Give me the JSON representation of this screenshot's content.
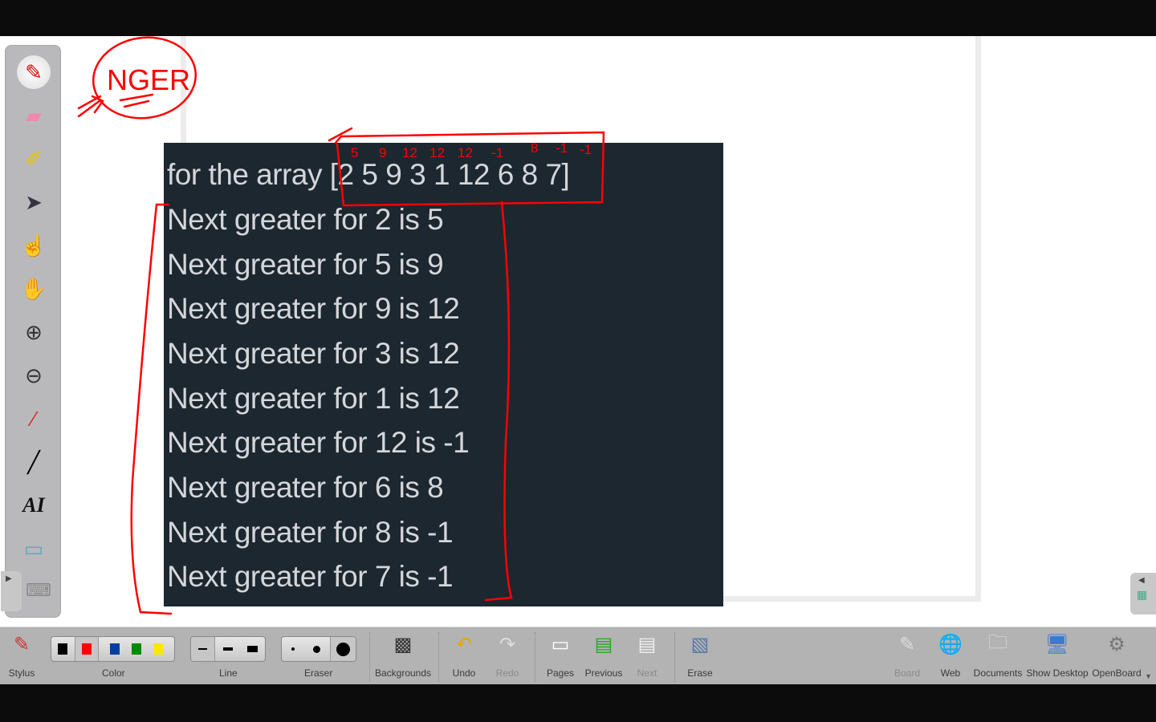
{
  "annotation": {
    "circled_text": "NGER",
    "ink_color": "#ff0000",
    "array_answers": [
      "5",
      "9",
      "12",
      "12",
      "12",
      "-1",
      "8",
      "-1",
      "-1"
    ]
  },
  "snapshot": {
    "header": "for the array [2 5 9 3 1 12 6 8 7]",
    "lines": [
      "Next greater for 2 is 5",
      "Next greater for 5 is 9",
      "Next greater for 9 is 12",
      "Next greater for 3 is 12",
      "Next greater for 1 is 12",
      "Next greater for 12 is -1",
      "Next greater for 6 is 8",
      "Next greater for 8 is -1",
      "Next greater for 7 is -1"
    ]
  },
  "left_tools": [
    "pen",
    "eraser",
    "marker",
    "selector",
    "play",
    "hand",
    "zoom-in",
    "zoom-out",
    "laser-pointer",
    "line",
    "text",
    "capture",
    "keyboard"
  ],
  "toolbar": {
    "stylus": "Stylus",
    "color": "Color",
    "line": "Line",
    "eraser": "Eraser",
    "backgrounds": "Backgrounds",
    "undo": "Undo",
    "redo": "Redo",
    "pages": "Pages",
    "previous": "Previous",
    "next": "Next",
    "erase": "Erase",
    "board": "Board",
    "web": "Web",
    "documents": "Documents",
    "show_desktop": "Show Desktop",
    "openboard": "OpenBoard"
  },
  "colors": [
    "#000000",
    "#ff0000",
    "#003f9e",
    "#008a00",
    "#ffe600"
  ]
}
